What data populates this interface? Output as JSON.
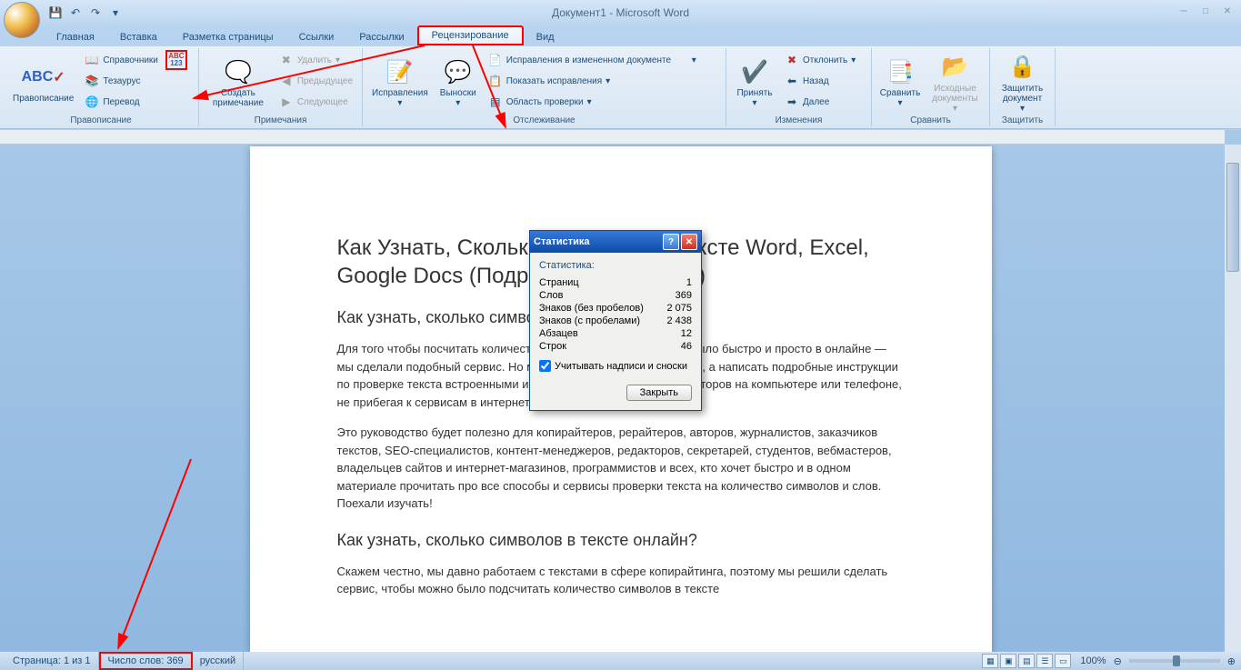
{
  "title": "Документ1 - Microsoft Word",
  "qat": {
    "save": "💾",
    "undo": "↶",
    "redo": "↷"
  },
  "tabs": [
    "Главная",
    "Вставка",
    "Разметка страницы",
    "Ссылки",
    "Рассылки",
    "Рецензирование",
    "Вид"
  ],
  "active_tab_index": 5,
  "ribbon": {
    "proofing": {
      "label": "Правописание",
      "spelling": "Правописание",
      "references": "Справочники",
      "thesaurus": "Тезаурус",
      "translate": "Перевод",
      "word_count_icon": "ABC 123"
    },
    "comments": {
      "label": "Примечания",
      "new_comment": "Создать примечание",
      "delete": "Удалить",
      "previous": "Предыдущее",
      "next": "Следующее"
    },
    "tracking": {
      "label": "Отслеживание",
      "track_changes": "Исправления",
      "balloons": "Выноски",
      "display_for_review": "Исправления в измененном документе",
      "show_markup": "Показать исправления",
      "reviewing_pane": "Область проверки"
    },
    "changes": {
      "label": "Изменения",
      "accept": "Принять",
      "reject": "Отклонить",
      "back": "Назад",
      "next": "Далее"
    },
    "compare": {
      "label": "Сравнить",
      "compare": "Сравнить",
      "source_docs": "Исходные документы"
    },
    "protect": {
      "label": "Защитить",
      "protect": "Защитить документ"
    }
  },
  "document": {
    "h1": "Как Узнать, Сколько Символов в Тексте Word, Excel, Google Docs (Подробный гайд 2019)",
    "h2_1": "Как узнать, сколько символов в тексте Word?",
    "p1": "Для того чтобы посчитать количество символов в тексте можно было быстро и просто в онлайне — мы сделали подобный сервис. Но мы решили не останавливаться, а написать подробные инструкции по проверке текста встроенными инструментами текстовых редакторов на компьютере или телефоне, не прибегая к сервисам в интернете.",
    "p2": "Это руководство будет полезно для копирайтеров, рерайтеров, авторов, журналистов, заказчиков текстов, SEO-специалистов, контент-менеджеров, редакторов, секретарей, студентов, вебмастеров, владельцев сайтов и интернет-магазинов, программистов и всех, кто хочет быстро и в одном материале прочитать про все способы и сервисы проверки текста на количество символов и слов. Поехали изучать!",
    "h2_2": "Как узнать, сколько символов в тексте онлайн?",
    "p3": "Скажем честно, мы давно работаем с текстами в сфере копирайтинга, поэтому мы решили сделать сервис, чтобы можно было подсчитать количество символов в тексте"
  },
  "dialog": {
    "title": "Статистика",
    "section": "Статистика:",
    "rows": [
      {
        "label": "Страниц",
        "value": "1"
      },
      {
        "label": "Слов",
        "value": "369"
      },
      {
        "label": "Знаков (без пробелов)",
        "value": "2 075"
      },
      {
        "label": "Знаков (с пробелами)",
        "value": "2 438"
      },
      {
        "label": "Абзацев",
        "value": "12"
      },
      {
        "label": "Строк",
        "value": "46"
      }
    ],
    "checkbox": "Учитывать надписи и сноски",
    "close": "Закрыть"
  },
  "status": {
    "page": "Страница: 1 из 1",
    "words": "Число слов: 369",
    "language": "русский",
    "zoom": "100%"
  }
}
